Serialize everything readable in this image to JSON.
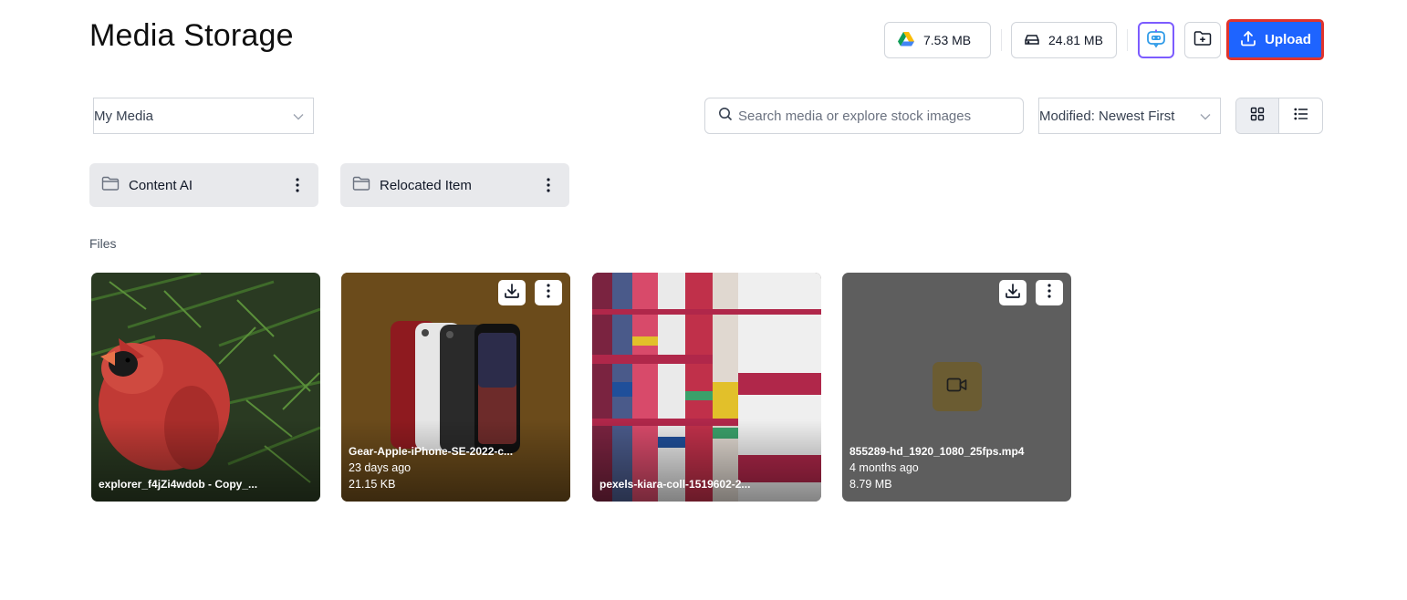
{
  "page": {
    "title": "Media Storage"
  },
  "header": {
    "gdrive_usage": "7.53 MB",
    "local_usage": "24.81 MB",
    "upload_label": "Upload"
  },
  "toolbar": {
    "source_selected": "My Media",
    "search_placeholder": "Search media or explore stock images",
    "sort_selected": "Modified: Newest First"
  },
  "folders": [
    {
      "name": "Content AI"
    },
    {
      "name": "Relocated Item"
    }
  ],
  "files_section_label": "Files",
  "files": [
    {
      "name": "explorer_f4jZi4wdob - Copy_...",
      "age": "",
      "size": ""
    },
    {
      "name": "Gear-Apple-iPhone-SE-2022-c...",
      "age": "23 days ago",
      "size": "21.15 KB"
    },
    {
      "name": "pexels-kiara-coll-1519602-2...",
      "age": "",
      "size": ""
    },
    {
      "name": "855289-hd_1920_1080_25fps.mp4",
      "age": "4 months ago",
      "size": "8.79 MB"
    }
  ],
  "colors": {
    "accent": "#1e64ff",
    "upload_outline": "#e1342c",
    "ai_button_border": "#7c5cff",
    "folder_bg": "#e8e9ec"
  },
  "icons": [
    "google-drive-icon",
    "hard-drive-icon",
    "ai-assistant-icon",
    "new-folder-icon",
    "upload-icon",
    "search-icon",
    "chevron-down-icon",
    "grid-view-icon",
    "list-view-icon",
    "folder-icon",
    "kebab-icon",
    "download-icon",
    "video-icon"
  ]
}
